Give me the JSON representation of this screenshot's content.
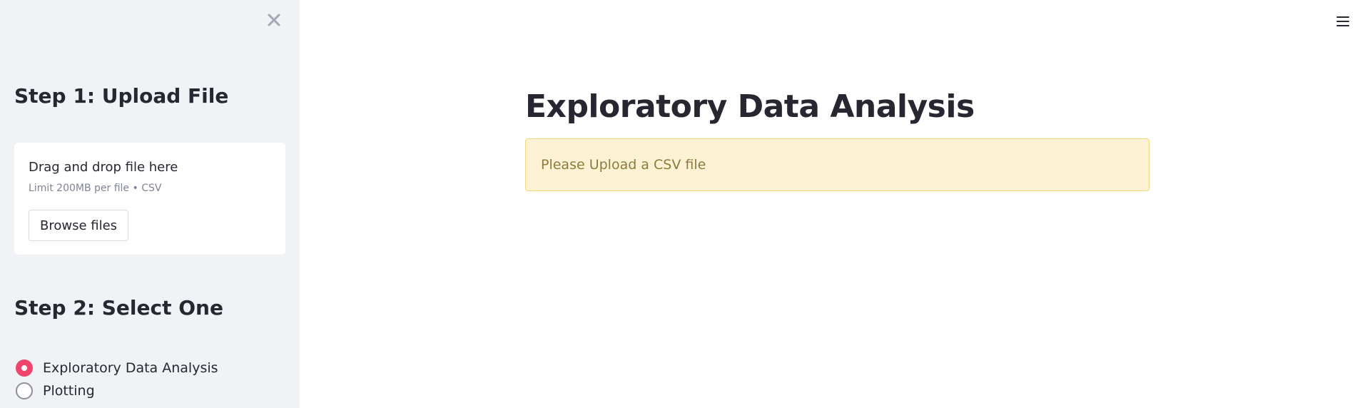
{
  "sidebar": {
    "step1_heading": "Step 1: Upload File",
    "uploader": {
      "drag_text": "Drag and drop file here",
      "limit_text": "Limit 200MB per file • CSV",
      "browse_label": "Browse files"
    },
    "step2_heading": "Step 2: Select One",
    "options": [
      {
        "label": "Exploratory Data Analysis",
        "selected": true
      },
      {
        "label": "Plotting",
        "selected": false
      }
    ],
    "close_icon": "close-icon"
  },
  "main": {
    "title": "Exploratory Data Analysis",
    "alert": {
      "type": "warning",
      "text": "Please Upload a CSV file"
    },
    "menu_icon": "hamburger-menu-icon"
  },
  "colors": {
    "sidebar_bg": "#f0f2f6",
    "accent": "#f0446a",
    "warning_bg": "#fdf3d4",
    "warning_border": "#f4d67e",
    "warning_text": "#8e7a3b",
    "text": "#262730"
  }
}
